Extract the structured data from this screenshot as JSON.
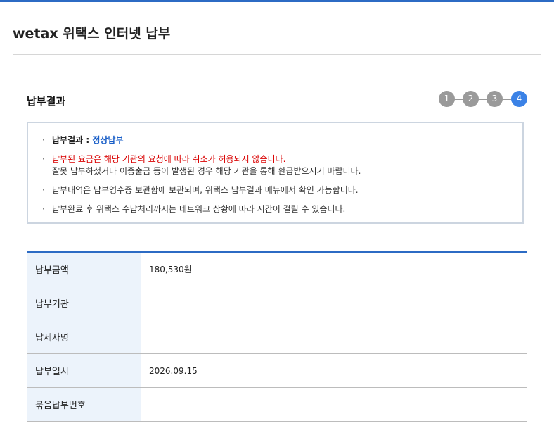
{
  "page": {
    "title": "wetax 위택스 인터넷 납부"
  },
  "section": {
    "title": "납부결과"
  },
  "steps": [
    {
      "label": "1",
      "active": false
    },
    {
      "label": "2",
      "active": false
    },
    {
      "label": "3",
      "active": false
    },
    {
      "label": "4",
      "active": true
    }
  ],
  "notices": {
    "result_label": "납부결과 : ",
    "result_value": "정상납부",
    "refund_warning": "납부된 요금은 해당 기관의 요청에 따라 취소가 허용되지 않습니다.",
    "refund_detail": "잘못 납부하셨거나 이중출금 등이 발생된 경우 해당 기관을 통해 환급받으시기 바랍니다.",
    "receipt_note": "납부내역은 납부영수증 보관함에 보관되며, 위택스 납부결과 메뉴에서 확인 가능합니다.",
    "network_note": "납부완료 후 위택스 수납처리까지는 네트워크 상황에 따라 시간이 걸릴 수 있습니다."
  },
  "table": {
    "rows": [
      {
        "label": "납부금액",
        "value": "180,530원"
      },
      {
        "label": "납부기관",
        "value": ""
      },
      {
        "label": "납세자명",
        "value": ""
      },
      {
        "label": "납부일시",
        "value": "2026.09.15"
      },
      {
        "label": "묶음납부번호",
        "value": ""
      }
    ]
  },
  "colors": {
    "accent": "#2c6bc4",
    "step_active": "#3b82e6",
    "step_inactive": "#9a9a9a",
    "warning": "#d90000",
    "value_blue": "#1a5fc8"
  }
}
